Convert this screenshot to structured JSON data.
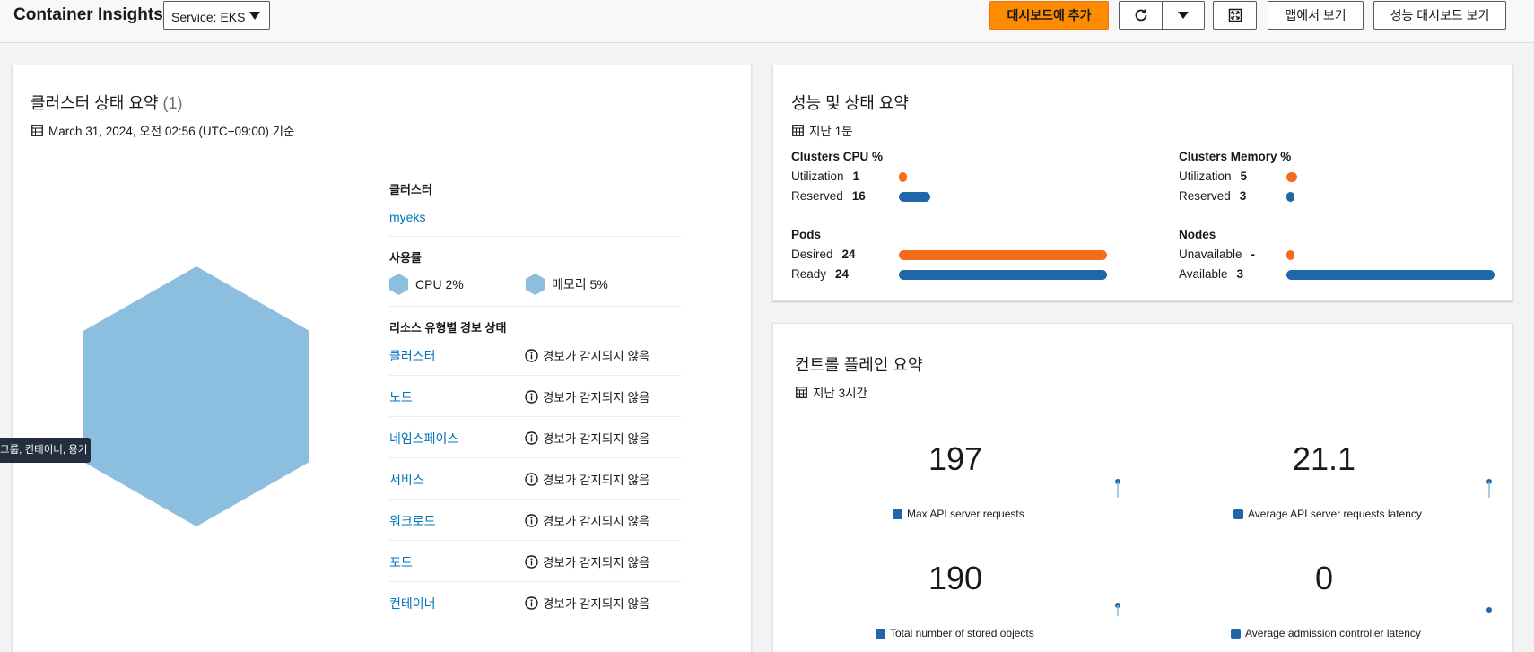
{
  "header": {
    "title": "Container Insights",
    "service_select": "Service: EKS",
    "add_dashboard": "대시보드에 추가",
    "view_map": "맵에서 보기",
    "view_perf_dashboard": "성능 대시보드 보기"
  },
  "cluster_summary": {
    "title": "클러스터 상태 요약",
    "count": "(1)",
    "timestamp": "March 31, 2024, 오전 02:56 (UTC+09:00) 기준",
    "cluster_label": "클러스터",
    "cluster_name": "myeks",
    "usage_label": "사용률",
    "cpu_usage": "CPU 2%",
    "mem_usage": "메모리 5%",
    "alarm_section_label": "리소스 유형별 경보 상태",
    "resources": [
      {
        "name": "클러스터",
        "status": "경보가 감지되지 않음"
      },
      {
        "name": "노드",
        "status": "경보가 감지되지 않음"
      },
      {
        "name": "네임스페이스",
        "status": "경보가 감지되지 않음"
      },
      {
        "name": "서비스",
        "status": "경보가 감지되지 않음"
      },
      {
        "name": "워크로드",
        "status": "경보가 감지되지 않음"
      },
      {
        "name": "포드",
        "status": "경보가 감지되지 않음"
      },
      {
        "name": "컨테이너",
        "status": "경보가 감지되지 않음"
      }
    ],
    "tooltip": "그룹, 컨테이너, 용기",
    "hex_color": "#8bbedf"
  },
  "performance": {
    "title": "성능 및 상태 요약",
    "period": "지난 1분",
    "cpu": {
      "title": "Clusters CPU %",
      "util_label": "Utilization",
      "util_value": "1",
      "reserved_label": "Reserved",
      "reserved_value": "16",
      "util_fraction": 0.01,
      "reserved_fraction": 0.16
    },
    "memory": {
      "title": "Clusters Memory %",
      "util_label": "Utilization",
      "util_value": "5",
      "reserved_label": "Reserved",
      "reserved_value": "3",
      "util_fraction": 0.05,
      "reserved_fraction": 0.03
    },
    "pods": {
      "title": "Pods",
      "desired_label": "Desired",
      "desired_value": "24",
      "ready_label": "Ready",
      "ready_value": "24",
      "desired_fraction": 1.0,
      "ready_fraction": 1.0
    },
    "nodes": {
      "title": "Nodes",
      "unavailable_label": "Unavailable",
      "unavailable_value": "-",
      "available_label": "Available",
      "available_value": "3",
      "unavailable_fraction": 0.0,
      "available_fraction": 1.0
    },
    "colors": {
      "orange": "#f56c1c",
      "blue": "#1f67a8"
    }
  },
  "control_plane": {
    "title": "컨트롤 플레인 요약",
    "period": "지난 3시간",
    "metrics": [
      {
        "value": "197",
        "label": "Max API server requests"
      },
      {
        "value": "21.1",
        "label": "Average API server requests latency"
      },
      {
        "value": "190",
        "label": "Total number of stored objects"
      },
      {
        "value": "0",
        "label": "Average admission controller latency"
      }
    ]
  }
}
